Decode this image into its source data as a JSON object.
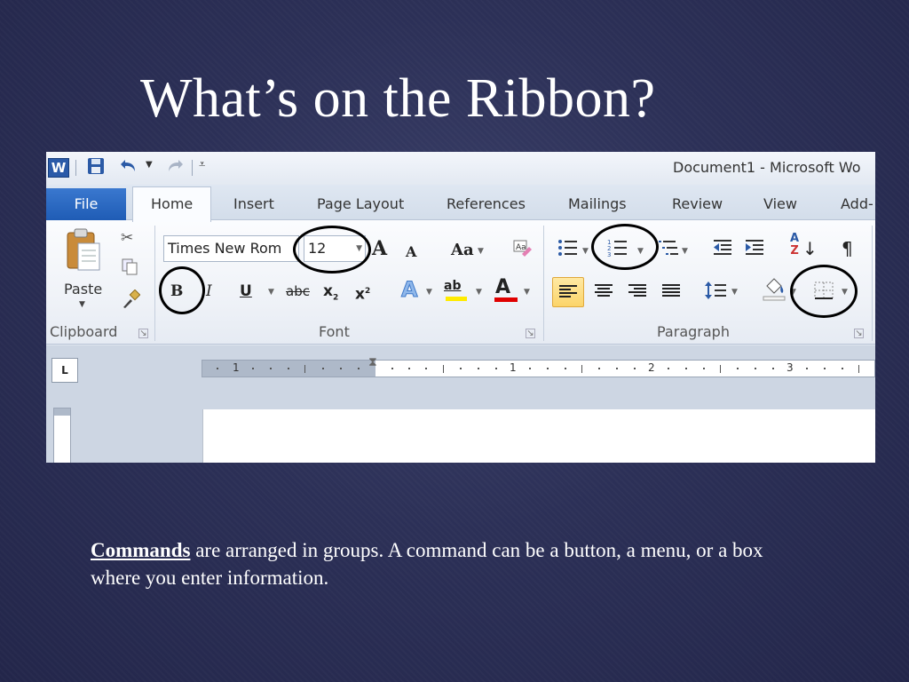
{
  "slide": {
    "title": "What’s on the Ribbon?",
    "caption": {
      "term": "Commands",
      "text": " are arranged in groups.  A command can be a button, a menu, or a box where you enter information."
    }
  },
  "word": {
    "app_icon_letter": "W",
    "window_title": "Document1  -  Microsoft Wo",
    "tabs": [
      {
        "label": "File"
      },
      {
        "label": "Home",
        "active": true
      },
      {
        "label": "Insert"
      },
      {
        "label": "Page Layout"
      },
      {
        "label": "References"
      },
      {
        "label": "Mailings"
      },
      {
        "label": "Review"
      },
      {
        "label": "View"
      },
      {
        "label": "Add-"
      }
    ],
    "groups": {
      "clipboard": {
        "label": "Clipboard",
        "paste_label": "Paste"
      },
      "font": {
        "label": "Font",
        "font_name": "Times New Rom",
        "font_size": "12",
        "grow": "A",
        "shrink": "A",
        "change_case": "Aa",
        "bold": "B",
        "italic": "I",
        "underline": "U",
        "strike": "abc",
        "subscript": "x",
        "superscript": "x",
        "text_effects": "A",
        "highlight": "ab",
        "font_color": "A"
      },
      "paragraph": {
        "label": "Paragraph",
        "sort": "A",
        "sort2": "Z",
        "pilcrow": "¶"
      }
    },
    "ruler": {
      "tab_selector": "L",
      "numbers": [
        "1",
        "1",
        "2",
        "3"
      ]
    },
    "icons": {
      "save": "save-icon",
      "undo": "undo-icon",
      "redo": "redo-icon",
      "cut": "scissors-icon",
      "copy": "copy-icon",
      "format_painter": "brush-icon",
      "shading": "paint-bucket-icon",
      "borders": "borders-icon"
    },
    "colors": {
      "file_tab": "#2a67c2",
      "highlight": "#ffeb00",
      "font_color": "#e00000",
      "active_button": "#fbd46a",
      "slide_bg": "#2c3057"
    }
  }
}
